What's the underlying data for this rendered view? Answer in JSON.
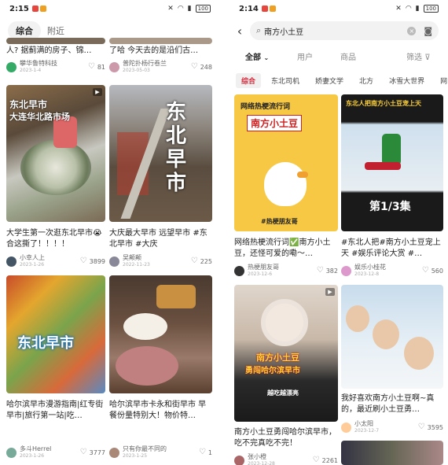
{
  "left": {
    "status": {
      "time": "2:15",
      "battery": "100"
    },
    "tabs": [
      {
        "label": "综合"
      },
      {
        "label": "附近"
      }
    ],
    "cards": [
      {
        "title": "人? 据蓟满的房子、锦…",
        "author": "攀华鲁特科技",
        "date": "2023-1-4",
        "likes": "81"
      },
      {
        "title": "了哈 今天去的是沿们古…",
        "author": "普陀扑杨行卷兰",
        "date": "2023-05-03",
        "likes": "248"
      },
      {
        "title": "大学生第一次逛东北早市😭合这撕了！！！！",
        "author": "小幸人上",
        "date": "2023-1-26",
        "likes": "3899",
        "overlay": [
          "东北早市",
          "大连华北路市场"
        ]
      },
      {
        "title": "大庆最大早市 远望早市 #东北早市 #大庆",
        "author": "吴颠颠",
        "date": "2022-11-23",
        "likes": "225",
        "overlay": [
          "东北早市"
        ]
      },
      {
        "title": "哈尔滨早市漫游指南|红专街早市|旅行第一站|吃…",
        "author": "多斗Herrel",
        "date": "2023-1-26",
        "likes": "3777",
        "overlay": [
          "东北早市"
        ]
      },
      {
        "title": "哈尔滨早市卡永和街早市 早餐份量特别大！物价特…",
        "author": "只有你最不同的",
        "date": "2023-1-25",
        "likes": "1"
      }
    ]
  },
  "right": {
    "status": {
      "time": "2:14",
      "battery": "100"
    },
    "search": {
      "query": "南方小土豆"
    },
    "filters": [
      {
        "label": "全部"
      },
      {
        "label": "用户"
      },
      {
        "label": "商品"
      },
      {
        "label": "筛选"
      }
    ],
    "chips": [
      {
        "label": "综合"
      },
      {
        "label": "东北司机"
      },
      {
        "label": "娇妻文学"
      },
      {
        "label": "北方"
      },
      {
        "label": "冰雪大世界"
      },
      {
        "label": "网"
      }
    ],
    "cards": [
      {
        "title": "网络热梗流行词✅南方小土豆，还怪可爱的嘞～…",
        "author": "热梗朋友哥",
        "date": "2023-12-6",
        "likes": "382",
        "overlay": [
          "网络热梗流行词",
          "南方小土豆",
          "#热梗朋友哥"
        ]
      },
      {
        "title": "#东北人把#南方小土豆宠上天 #娱乐评论大赏 #…",
        "author": "娱乐小桂花",
        "date": "2023-12-8",
        "likes": "560",
        "overlay": [
          "东北人把南方小土豆宠上天",
          "第1/3集"
        ]
      },
      {
        "title": "南方小土豆勇闯哈尔滨早市，吃不完真吃不完！",
        "author": "张小橙",
        "date": "2023-12-28",
        "likes": "2261",
        "overlay": [
          "南方小土豆",
          "勇闯哈尔滨早市",
          "越吃越漂亮"
        ]
      },
      {
        "title": "我好喜欢南方小土豆啊~真的，最近刷小土豆勇…",
        "author": "小太阳",
        "date": "2023-12-7",
        "likes": "3595"
      }
    ]
  }
}
